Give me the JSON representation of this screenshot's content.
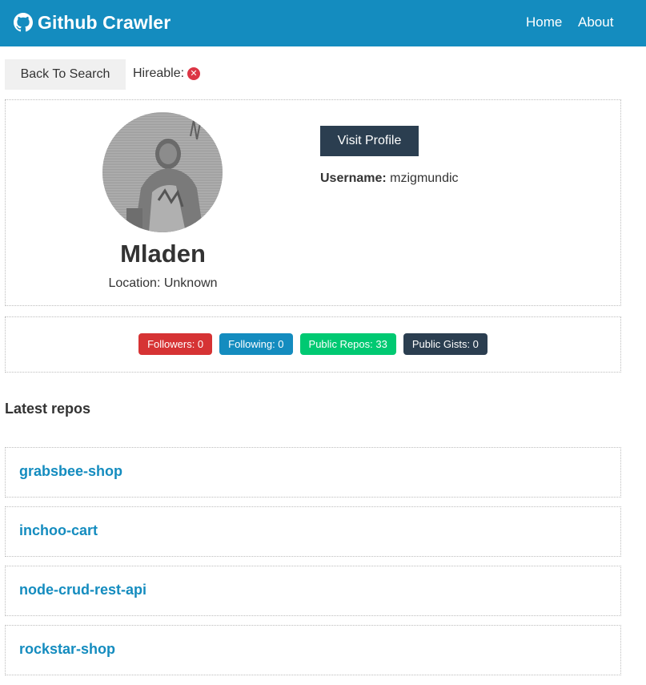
{
  "navbar": {
    "brand_title": "Github Crawler",
    "brand_icon": "github-icon",
    "links": [
      "Home",
      "About"
    ]
  },
  "toolbar": {
    "back_label": "Back To Search",
    "hireable_label": "Hireable:",
    "hireable_icon": "close-circle-icon",
    "hireable_value": false
  },
  "profile": {
    "name": "Mladen",
    "location_label": "Location: Unknown",
    "visit_label": "Visit Profile",
    "username_label": "Username:",
    "username_value": "mzigmundic"
  },
  "stats": [
    {
      "label": "Followers: 0",
      "color": "#d63334"
    },
    {
      "label": "Following: 0",
      "color": "#148cbf"
    },
    {
      "label": "Public Repos: 33",
      "color": "#00c972"
    },
    {
      "label": "Public Gists: 0",
      "color": "#2b3e50"
    }
  ],
  "repos_section": {
    "title": "Latest repos",
    "items": [
      "grabsbee-shop",
      "inchoo-cart",
      "node-crud-rest-api",
      "rockstar-shop"
    ]
  },
  "colors": {
    "primary": "#148cbf",
    "dark": "#2b3e50",
    "danger": "#d63334",
    "success": "#00c972"
  }
}
